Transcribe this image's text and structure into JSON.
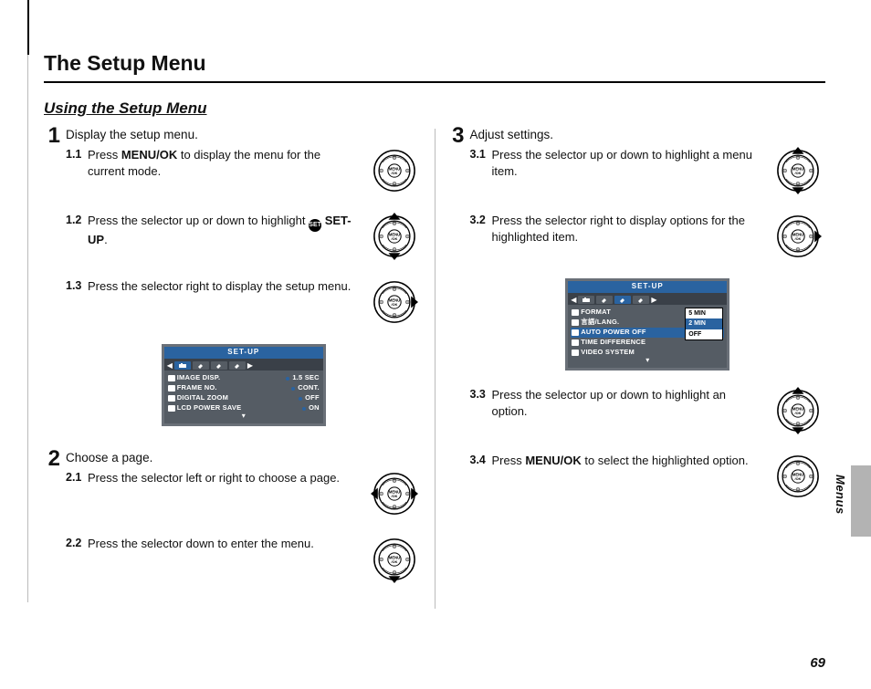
{
  "page_title": "The Setup Menu",
  "section_title": "Using the Setup Menu",
  "side_label": "Menus",
  "page_number": "69",
  "selector_center": {
    "line1": "MENU",
    "line2": "/OK"
  },
  "setup_badge": "SET",
  "steps": {
    "s1": {
      "num": "1",
      "title": "Display the setup menu.",
      "subs": {
        "a": {
          "num": "1.1",
          "pre": "Press ",
          "bold": "MENU/OK",
          "post": " to display the menu for the current mode."
        },
        "b": {
          "num": "1.2",
          "pre": "Press the selector up or down to highlight ",
          "bold": "SET-UP",
          "post": "."
        },
        "c": {
          "num": "1.3",
          "text": "Press the selector right to display the setup menu."
        }
      }
    },
    "s2": {
      "num": "2",
      "title": "Choose a page.",
      "subs": {
        "a": {
          "num": "2.1",
          "text": "Press the selector left or right to choose a page."
        },
        "b": {
          "num": "2.2",
          "text": "Press the selector down to enter the menu."
        }
      }
    },
    "s3": {
      "num": "3",
      "title": "Adjust settings.",
      "subs": {
        "a": {
          "num": "3.1",
          "text": "Press the selector up or down to highlight a menu item."
        },
        "b": {
          "num": "3.2",
          "text": "Press the selector right to display options for the highlighted item."
        },
        "c": {
          "num": "3.3",
          "text": "Press the selector up or down to highlight an option."
        },
        "d": {
          "num": "3.4",
          "pre": "Press ",
          "bold": "MENU/OK",
          "post": " to select the highlighted option."
        }
      }
    }
  },
  "lcd1": {
    "title": "SET-UP",
    "rows": [
      {
        "label": "IMAGE DISP.",
        "value": "1.5 SEC"
      },
      {
        "label": "FRAME NO.",
        "value": "CONT."
      },
      {
        "label": "DIGITAL ZOOM",
        "value": "OFF"
      },
      {
        "label": "LCD POWER SAVE",
        "value": "ON"
      }
    ]
  },
  "lcd2": {
    "title": "SET-UP",
    "rows": [
      {
        "label": "FORMAT"
      },
      {
        "label": "言語/LANG."
      },
      {
        "label": "AUTO POWER OFF",
        "hl": true
      },
      {
        "label": "TIME DIFFERENCE"
      },
      {
        "label": "VIDEO SYSTEM"
      }
    ],
    "options": [
      "5 MIN",
      "2 MIN",
      "OFF"
    ],
    "selected": "2 MIN"
  }
}
